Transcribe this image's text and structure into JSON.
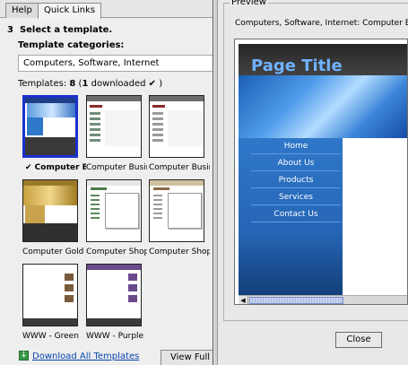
{
  "tabs": [
    {
      "label": "Help",
      "active": false
    },
    {
      "label": "Quick Links",
      "active": true
    }
  ],
  "step": {
    "number": "3",
    "title": "Select a template."
  },
  "categories": {
    "label": "Template categories:",
    "selected": "Computers, Software, Internet"
  },
  "templates_count": {
    "prefix": "Templates: ",
    "count": "8",
    "open": " (",
    "downloaded": "1",
    "downloaded_label": " downloaded",
    "check": "✔",
    "close": " )"
  },
  "templates": [
    {
      "caption": "✔ Computer Bl",
      "selected": true
    },
    {
      "caption": "Computer Busines",
      "selected": false
    },
    {
      "caption": "Computer Busines",
      "selected": false
    },
    {
      "caption": "Computer Gold - (",
      "selected": false
    },
    {
      "caption": "Computer Shop - ",
      "selected": false
    },
    {
      "caption": "Computer Shop - ",
      "selected": false
    },
    {
      "caption": "WWW - Green",
      "selected": false
    },
    {
      "caption": "WWW - Purple",
      "selected": false
    }
  ],
  "download_link": "Download All Templates",
  "view_full_button": "View Full S",
  "preview": {
    "legend": "Preview",
    "caption": "Computers, Software, Internet: Computer Blue",
    "site_title": "Page Title",
    "nav": [
      "Home",
      "About Us",
      "Products",
      "Services",
      "Contact Us"
    ],
    "scroll_left_arrow": "◀",
    "close_button": "Close"
  },
  "colors": {
    "accent_selected": "#1c2fd0",
    "site_blue": "#2f77c9",
    "site_title": "#6fb2ff",
    "link": "#0645ad"
  }
}
